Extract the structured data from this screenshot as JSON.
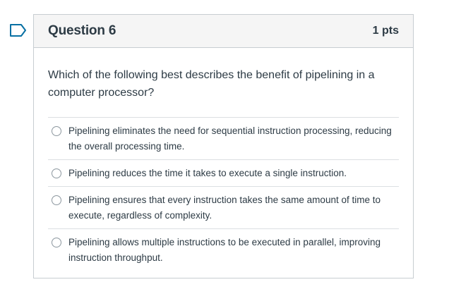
{
  "question": {
    "title": "Question 6",
    "points": "1 pts",
    "text": "Which of the following best describes the benefit of pipelining in a computer processor?",
    "answers": [
      {
        "label": "Pipelining eliminates the need for sequential instruction processing, reducing the overall processing time."
      },
      {
        "label": "Pipelining reduces the time it takes to execute a single instruction."
      },
      {
        "label": "Pipelining ensures that every instruction takes the same amount of time to execute, regardless of complexity."
      },
      {
        "label": "Pipelining allows multiple instructions to be executed in parallel, improving instruction throughput."
      }
    ]
  },
  "colors": {
    "flag_outline": "#0770a3",
    "text": "#2d3b45",
    "border": "#c7cdd1",
    "header_bg": "#f5f5f5"
  },
  "icons": {
    "flag": "flag-question-icon",
    "radio": "radio-unselected"
  }
}
